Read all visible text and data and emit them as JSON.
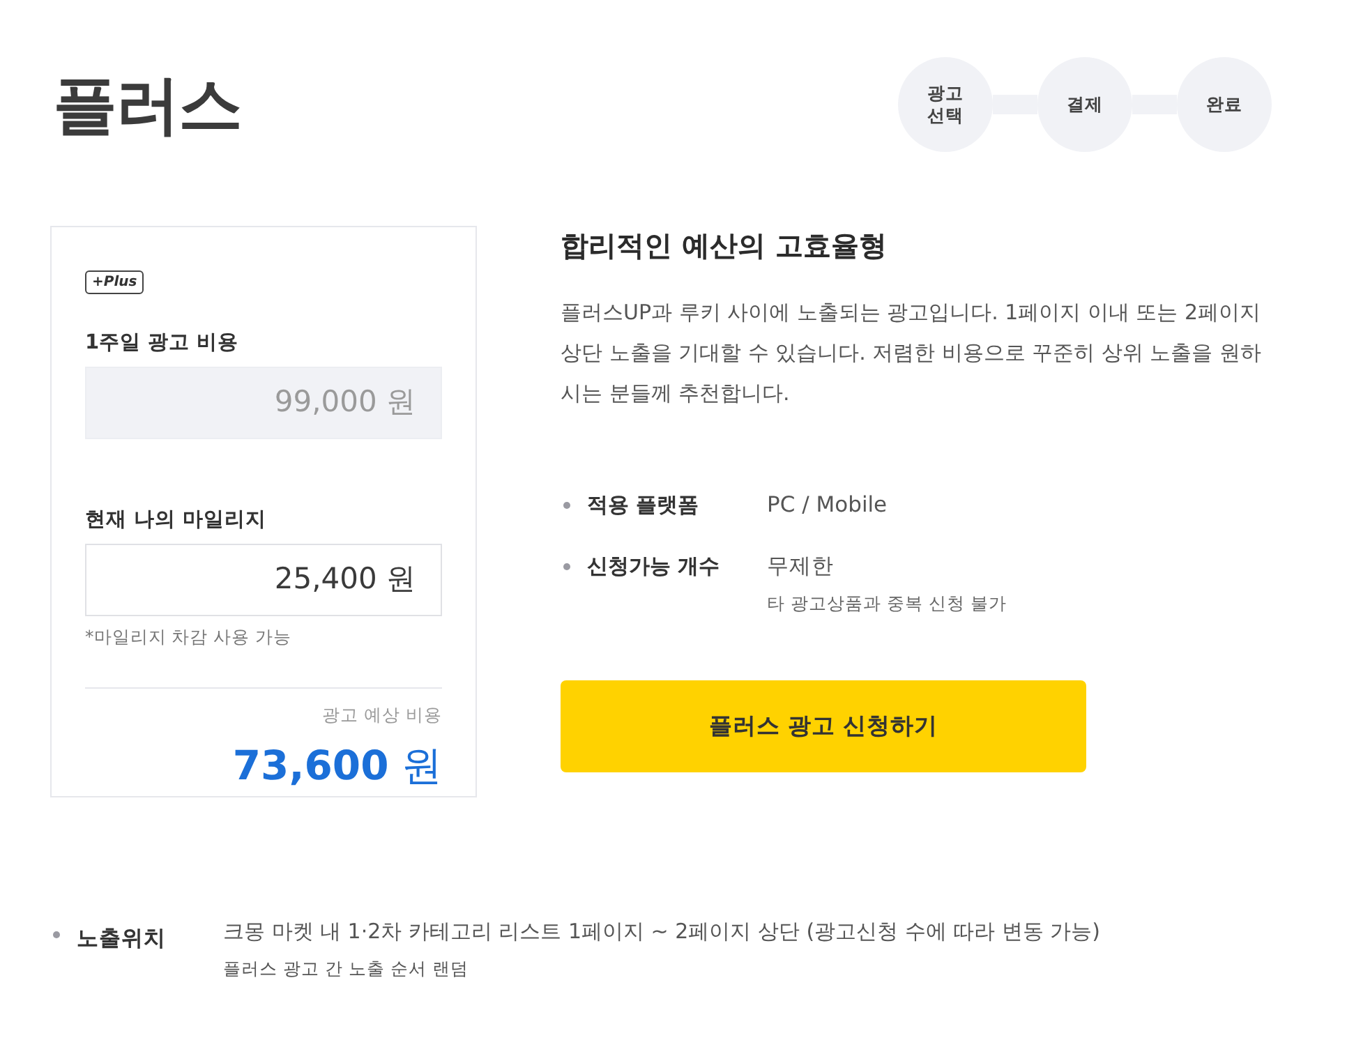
{
  "page": {
    "title": "플러스"
  },
  "steps": [
    {
      "label": "광고 선택"
    },
    {
      "label": "결제"
    },
    {
      "label": "완료"
    }
  ],
  "cost_card": {
    "badge": "+Plus",
    "fields": [
      {
        "label": "1주일 광고 비용",
        "value": "99,000 원",
        "disabled": true
      },
      {
        "label": "현재 나의 마일리지",
        "value": "25,400 원",
        "disabled": false,
        "note": "*마일리지 차감 사용 가능"
      }
    ],
    "total": {
      "label": "광고 예상 비용",
      "amount": "**73,600** 원"
    }
  },
  "product": {
    "heading": "합리적인 예산의 고효율형",
    "description": "플러스UP과 루키 사이에 노출되는 광고입니다. 1페이지 이내 또는 2페이지 상단 노출을 기대할 수 있습니다. 저렴한 비용으로 꾸준히 상위 노출을 원하시는 분들께 추천합니다.",
    "specs": [
      {
        "label": "적용 플랫폼",
        "value": "PC / Mobile"
      },
      {
        "label": "신청가능 개수",
        "value": "무제한",
        "note": "타 광고상품과 중복 신청 불가"
      }
    ],
    "apply_button": "플러스 광고 신청하기"
  },
  "placement": {
    "label": "노출위치",
    "value": "크몽 마켓 내 1·2차 카테고리 리스트 1페이지 ~ 2페이지 상단 (광고신청 수에 따라 변동 가능)",
    "note": "플러스 광고 간 노출 순서 랜덤"
  }
}
